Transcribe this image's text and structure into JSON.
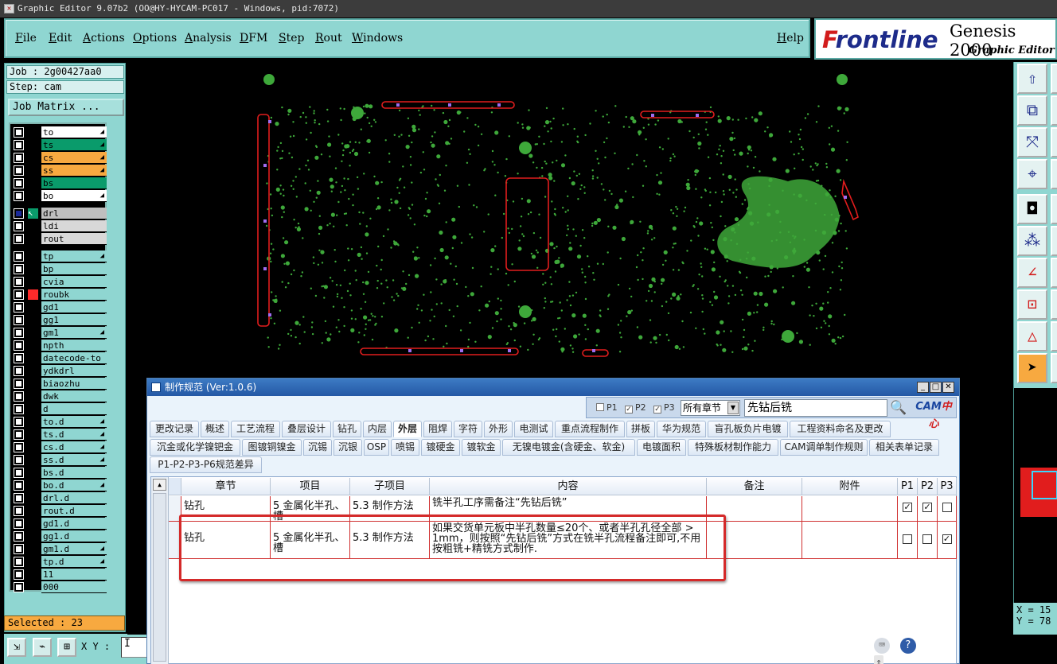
{
  "window": {
    "title": "Graphic Editor 9.07b2 (OO@HY-HYCAM-PC017 - Windows, pid:7072)"
  },
  "menu": [
    "File",
    "Edit",
    "Actions",
    "Options",
    "Analysis",
    "DFM",
    "Step",
    "Rout",
    "Windows"
  ],
  "help": "Help",
  "brand": {
    "logo_f": "F",
    "logo_rest": "rontline",
    "product": "Genesis 2000",
    "subtitle": "Graphic Editor"
  },
  "job": {
    "job": "Job : 2g00427aa0",
    "step": "Step: cam",
    "matrix_button": "Job Matrix ..."
  },
  "layers": [
    {
      "name": "to",
      "color": "#ffffff",
      "arrow": true
    },
    {
      "name": "ts",
      "color": "#0a9b6b",
      "arrow": true
    },
    {
      "name": "cs",
      "color": "#f7a940",
      "arrow": true
    },
    {
      "name": "ss",
      "color": "#f7a940",
      "arrow": true
    },
    {
      "name": "bs",
      "color": "#0a9b6b",
      "arrow": false
    },
    {
      "name": "bo",
      "color": "#ffffff",
      "arrow": true
    },
    {
      "name": "drl",
      "color": "#bfbfbf",
      "arrow": false,
      "work": true
    },
    {
      "name": "ldi",
      "color": "#d8d8d8",
      "arrow": false
    },
    {
      "name": "rout",
      "color": "#d8d8d8",
      "arrow": false
    },
    {
      "name": "tp",
      "color": "#8fd6d1",
      "arrow": true
    },
    {
      "name": "bp",
      "color": "#8fd6d1",
      "arrow": false
    },
    {
      "name": "cvia",
      "color": "#8fd6d1",
      "arrow": false
    },
    {
      "name": "roubk",
      "color": "#8fd6d1",
      "arrow": false,
      "red": true
    },
    {
      "name": "gd1",
      "color": "#8fd6d1",
      "arrow": false
    },
    {
      "name": "gg1",
      "color": "#8fd6d1",
      "arrow": false
    },
    {
      "name": "gm1",
      "color": "#8fd6d1",
      "arrow": true
    },
    {
      "name": "npth",
      "color": "#8fd6d1",
      "arrow": false
    },
    {
      "name": "datecode-to",
      "color": "#8fd6d1",
      "arrow": false
    },
    {
      "name": "ydkdrl",
      "color": "#8fd6d1",
      "arrow": false
    },
    {
      "name": "biaozhu",
      "color": "#8fd6d1",
      "arrow": false
    },
    {
      "name": "dwk",
      "color": "#8fd6d1",
      "arrow": false
    },
    {
      "name": "d",
      "color": "#8fd6d1",
      "arrow": false
    },
    {
      "name": "to.d",
      "color": "#8fd6d1",
      "arrow": true
    },
    {
      "name": "ts.d",
      "color": "#8fd6d1",
      "arrow": true
    },
    {
      "name": "cs.d",
      "color": "#8fd6d1",
      "arrow": true
    },
    {
      "name": "ss.d",
      "color": "#8fd6d1",
      "arrow": true
    },
    {
      "name": "bs.d",
      "color": "#8fd6d1",
      "arrow": false
    },
    {
      "name": "bo.d",
      "color": "#8fd6d1",
      "arrow": true
    },
    {
      "name": "drl.d",
      "color": "#8fd6d1",
      "arrow": false
    },
    {
      "name": "rout.d",
      "color": "#8fd6d1",
      "arrow": false
    },
    {
      "name": "gd1.d",
      "color": "#8fd6d1",
      "arrow": false
    },
    {
      "name": "gg1.d",
      "color": "#8fd6d1",
      "arrow": false
    },
    {
      "name": "gm1.d",
      "color": "#8fd6d1",
      "arrow": true
    },
    {
      "name": "tp.d",
      "color": "#8fd6d1",
      "arrow": true
    },
    {
      "name": "11",
      "color": "#8fd6d1",
      "arrow": false
    },
    {
      "name": "000",
      "color": "#8fd6d1",
      "arrow": false
    }
  ],
  "status": {
    "selected": "Selected : 23",
    "xy_label": "X Y :",
    "coord_x": "X = 15",
    "coord_y": "Y = 78"
  },
  "dialog": {
    "title": "制作规范 (Ver:1.0.6)",
    "filters": {
      "p1": "P1",
      "p2": "P2",
      "p3": "P3",
      "p1_checked": false,
      "p2_checked": true,
      "p3_checked": true
    },
    "chapter_select": "所有章节",
    "search_value": "先钻后铣",
    "cam_logo_a": "CAM",
    "cam_logo_b": "中心",
    "tabs_row1": [
      "更改记录",
      "概述",
      "工艺流程",
      "叠层设计",
      "钻孔",
      "内层",
      "外层",
      "阻焊",
      "字符",
      "外形",
      "电测试",
      "重点流程制作",
      "拼板",
      "华为规范",
      "盲孔板负片电镀",
      "工程资料命名及更改"
    ],
    "active_tab": "外层",
    "tabs_row2": [
      "沉金或化学镍钯金",
      "图镀铜镍金",
      "沉锡",
      "沉银",
      "OSP",
      "喷锡",
      "镀硬金",
      "镀软金",
      "无镍电镀金(含硬金、软金)",
      "电镀面积",
      "特殊板材制作能力",
      "CAM调单制作规则",
      "相关表单记录"
    ],
    "tabs_row3": [
      "P1-P2-P3-P6规范差异"
    ],
    "columns": [
      "章节",
      "项目",
      "子项目",
      "内容",
      "备注",
      "附件",
      "P1",
      "P2",
      "P3"
    ],
    "rows": [
      {
        "chapter": "钻孔",
        "item": "5 金属化半孔、槽",
        "subitem": "5.3 制作方法",
        "content": "铣半孔工序需备注“先钻后铣”",
        "note": "",
        "attach": "",
        "p1": true,
        "p2": true,
        "p3": false
      },
      {
        "chapter": "钻孔",
        "item": "5 金属化半孔、槽",
        "subitem": "5.3 制作方法",
        "content": "如果交货单元板中半孔数量≤20个、或者半孔孔径全部 > 1mm，则按照“先钻后铣”方式在铣半孔流程备注即可,不用按粗铣+精铣方式制作.",
        "note": "",
        "attach": "",
        "p1": false,
        "p2": false,
        "p3": true
      }
    ]
  },
  "colors": {
    "panel": "#8fd6d1",
    "canvas": "#000000",
    "pads": "#3ea83a",
    "rout": "#e11d1d",
    "selection": "#9f6df0",
    "highlight": "#d42a2a"
  }
}
